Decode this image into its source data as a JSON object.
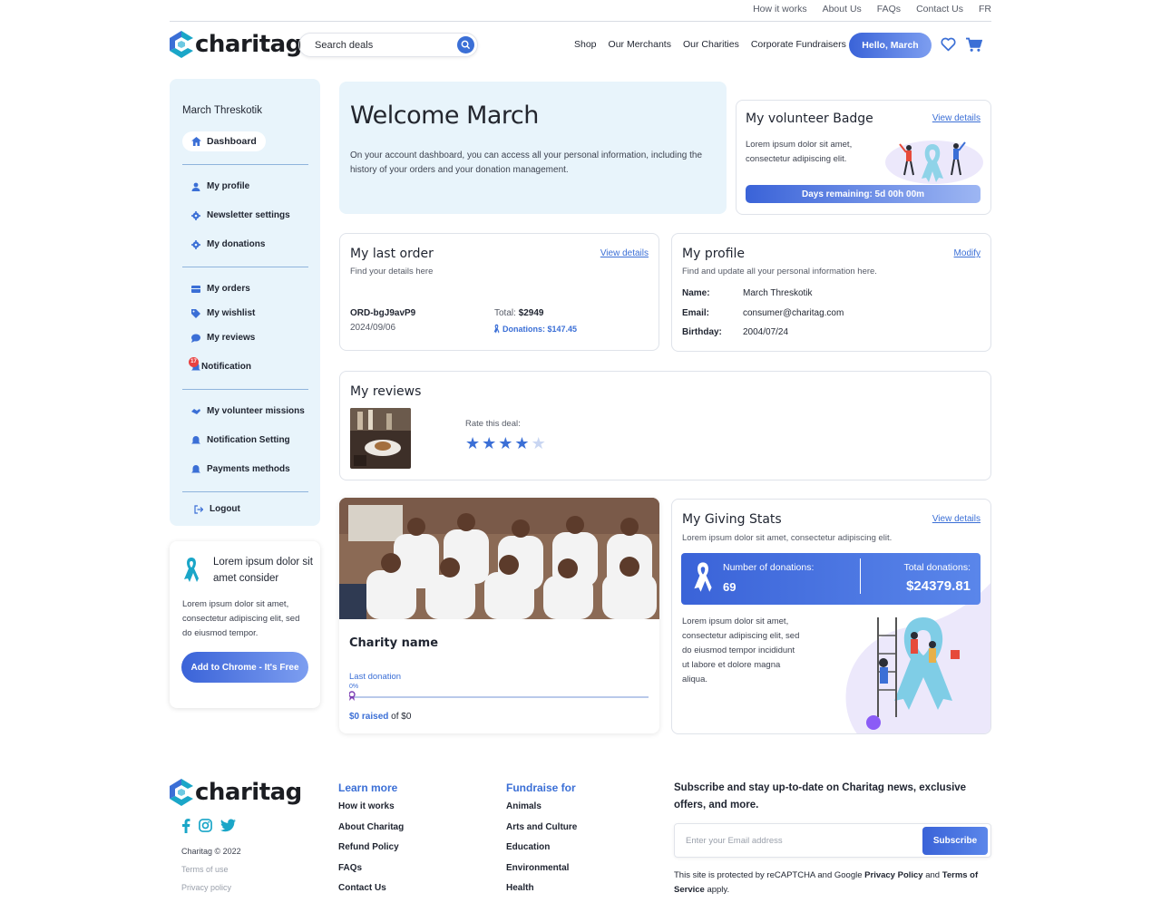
{
  "toplinks": [
    "How it works",
    "About Us",
    "FAQs",
    "Contact Us",
    "FR"
  ],
  "logo": {
    "text": "charitag"
  },
  "search": {
    "placeholder": "Search deals"
  },
  "nav": [
    "Shop",
    "Our Merchants",
    "Our Charities",
    "Corporate Fundraisers"
  ],
  "hello_label": "Hello, March",
  "sidebar": {
    "name": "March Threskotik",
    "dashboard": "Dashboard",
    "group1": [
      "My profile",
      "Newsletter settings",
      "My donations"
    ],
    "group2": [
      "My orders",
      "My wishlist",
      "My reviews",
      "Notification"
    ],
    "notification_count": "17",
    "group3": [
      "My volunteer missions",
      "Notification Setting",
      "Payments methods"
    ],
    "logout": "Logout"
  },
  "promo": {
    "title": "Lorem ipsum dolor sit amet consider",
    "text": "Lorem ipsum dolor sit amet, consectetur adipiscing elit, sed do eiusmod tempor.",
    "button": "Add to Chrome - It's Free"
  },
  "welcome": {
    "title": "Welcome March",
    "text": "On your account dashboard, you can access all your personal information, including the history of your orders and your donation management."
  },
  "volunteer": {
    "title": "My volunteer Badge",
    "link": "View details",
    "text": "Lorem ipsum dolor sit amet, consectetur adipiscing elit.",
    "days": "Days remaining: 5d 00h 00m"
  },
  "last_order": {
    "title": "My last order",
    "link": "View details",
    "subtitle": "Find your details here",
    "order_id": "ORD-bgJ9avP9",
    "date": "2024/09/06",
    "total_label": "Total:",
    "total_value": "$2949",
    "donations": "Donations: $147.45"
  },
  "profile": {
    "title": "My profile",
    "link": "Modify",
    "subtitle": "Find and update all your personal information here.",
    "rows": [
      {
        "label": "Name:",
        "value": "March Threskotik"
      },
      {
        "label": "Email:",
        "value": "consumer@charitag.com"
      },
      {
        "label": "Birthday:",
        "value": "2004/07/24"
      }
    ]
  },
  "reviews": {
    "title": "My reviews",
    "rate_label": "Rate this deal:",
    "rating": 4,
    "max_rating": 5
  },
  "charity": {
    "name": "Charity name",
    "last_donation": "Last donation",
    "percent": "0%",
    "raised": "$0 raised",
    "of": "of $0"
  },
  "giving": {
    "title": "My Giving Stats",
    "link": "View details",
    "subtitle": "Lorem ipsum dolor sit amet, consectetur adipiscing elit.",
    "count_label": "Number of donations:",
    "count_value": "69",
    "total_label": "Total donations:",
    "total_value": "$24379.81",
    "text": "Lorem ipsum dolor sit amet, consectetur adipiscing elit, sed do eiusmod tempor incididunt ut labore et dolore magna aliqua."
  },
  "footer": {
    "copyright": "Charitag © 2022",
    "terms": "Terms of use",
    "privacy": "Privacy policy",
    "learn_title": "Learn more",
    "learn_items": [
      "How it works",
      "About Charitag",
      "Refund Policy",
      "FAQs",
      "Contact Us"
    ],
    "fund_title": "Fundraise for",
    "fund_items": [
      "Animals",
      "Arts and Culture",
      "Education",
      "Environmental",
      "Health"
    ],
    "subscribe_title": "Subscribe and stay up-to-date on Charitag news, exclusive offers, and more.",
    "email_placeholder": "Enter your Email address",
    "subscribe_button": "Subscribe",
    "recaptcha_pre": "This site is protected by reCAPTCHA and Google ",
    "privacy_policy": "Privacy Policy",
    "and": " and ",
    "terms_of_service": "Terms of Service",
    "apply": " apply."
  },
  "colors": {
    "accent": "#3b6fd6",
    "panel": "#e8f4fb",
    "teal": "#1aa6c8"
  }
}
